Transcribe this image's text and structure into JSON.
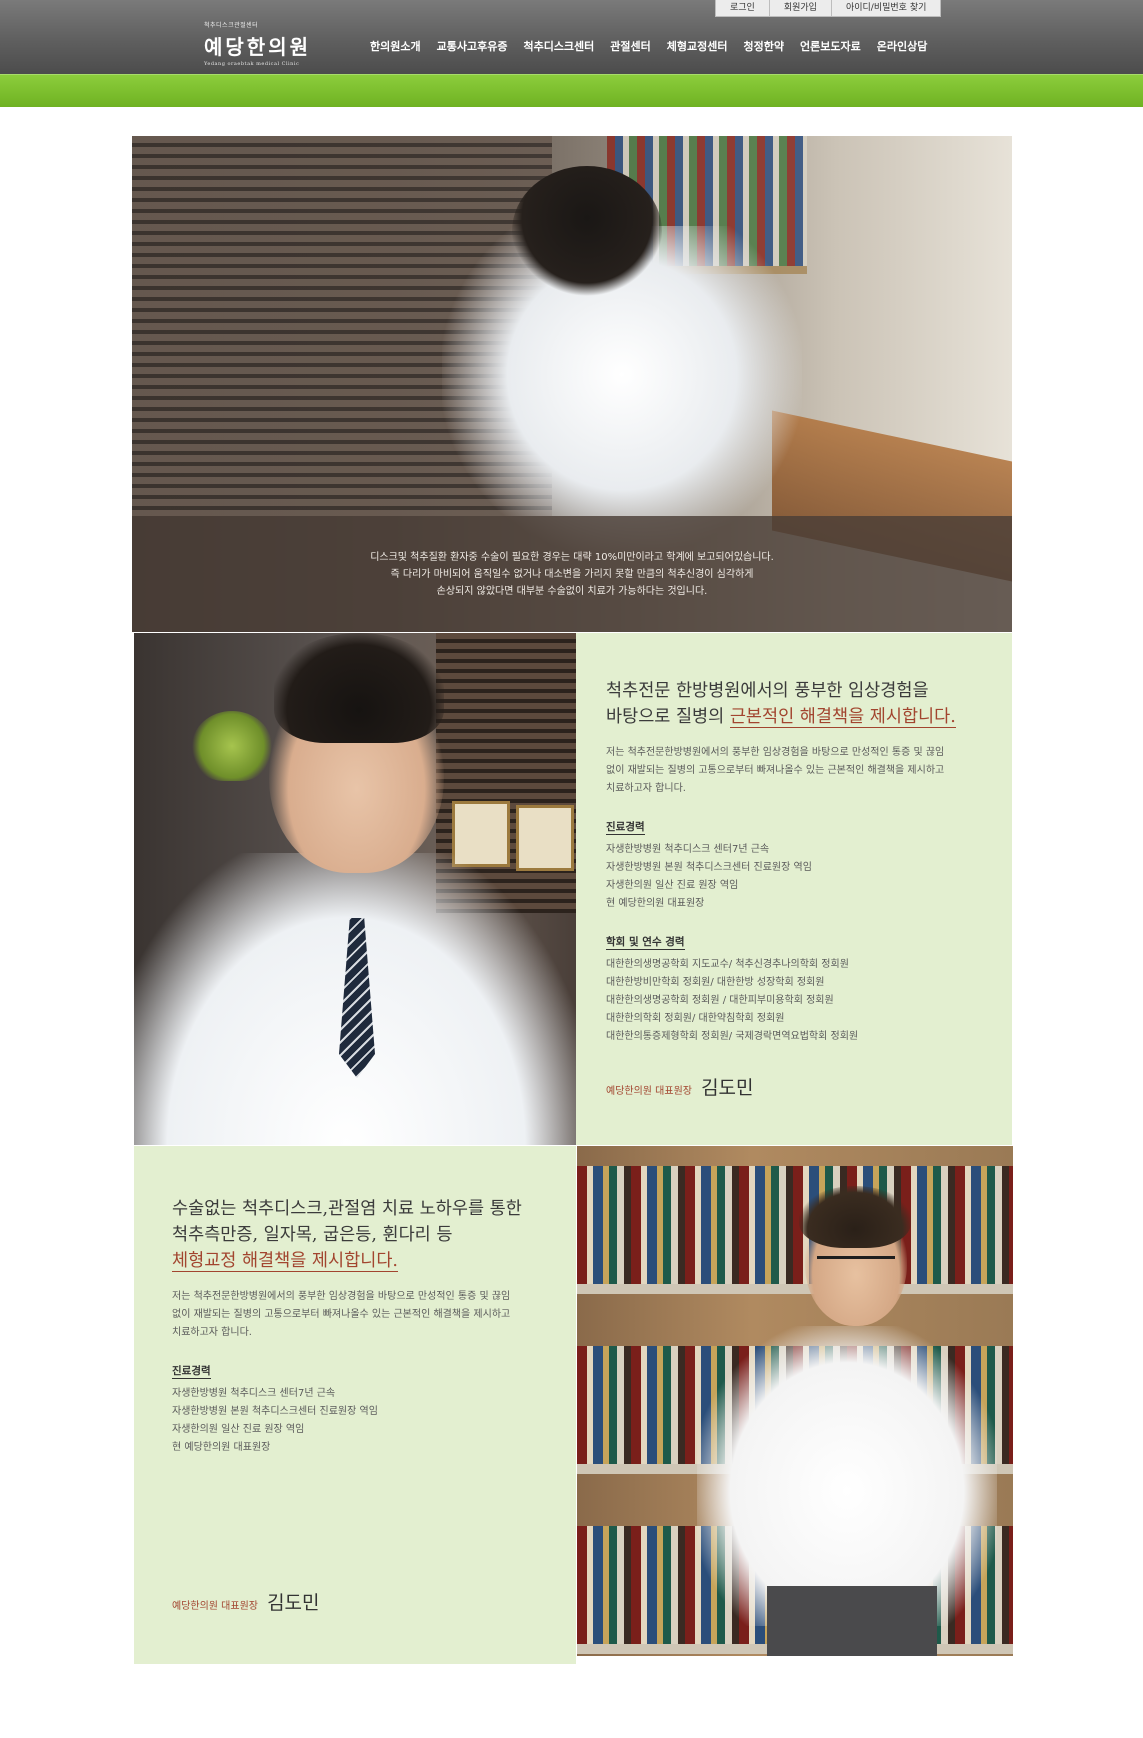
{
  "header": {
    "logo_small": "척추디스크관절센터",
    "logo_main": "예당한의원",
    "logo_en": "Yedang oraebtak medical Clinic",
    "util": [
      "로그인",
      "회원가입",
      "아이디/비밀번호 찾기"
    ],
    "nav": [
      "한의원소개",
      "교통사고후유증",
      "척추디스크센터",
      "관절센터",
      "체형교정센터",
      "청정한약",
      "언론보도자료",
      "온라인상담"
    ]
  },
  "hero": {
    "caption": [
      "디스크및 척추질환 환자중 수술이 필요한 경우는 대략 10%미만이라고 학계에 보고되어있습니다.",
      "즉 다리가 마비되어 움직일수 없거나 대소변을 가리지 못할 만큼의 척추신경이 심각하게",
      "손상되지 않았다면 대부분 수술없이 치료가 가능하다는 것입니다."
    ]
  },
  "doctor1": {
    "headline_line1": "척추전문 한방병원에서의 풍부한 임상경험을",
    "headline_line2_prefix": "바탕으로 질병의 ",
    "headline_line2_accent": "근본적인 해결책을 제시합니다.",
    "intro": [
      "저는 척추전문한방병원에서의 풍부한 임상경험을 바탕으로 만성적인 통증 및 끊임",
      "없이 재발되는 질병의 고통으로부터 빠져나올수 있는 근본적인 해결책을 제시하고",
      "치료하고자 합니다."
    ],
    "career_title": "진료경력",
    "career": [
      "자생한방병원 척추디스크 센터7년 근속",
      "자생한방병원 본원 척추디스크센터 진료원장 역임",
      "자생한의원 일산 진료 원장 역임",
      "현 예당한의원 대표원장"
    ],
    "academic_title": "학회 및 연수 경력",
    "academic": [
      "대한한의생명공학회 지도교수/ 척추신경추나의학회 정회원",
      "대한한방비만학회 정회원/ 대한한방 성장학회 정회원",
      "대한한의생명공학회 정회원 / 대한피부미용학회 정회원",
      "대한한의학회 정회원/ 대한약침학회 정회원",
      "대한한의통증제형학회 정회원/ 국제경락면역요법학회 정회원"
    ],
    "sig_title": "예당한의원 대표원장",
    "sig_name": "김도민"
  },
  "doctor2": {
    "headline_line1": "수술없는 척추디스크,관절염 치료 노하우를 통한",
    "headline_line2": "척추측만증, 일자목, 굽은등, 휜다리 등",
    "headline_line3_accent": "체형교정 해결책을 제시합니다.",
    "intro": [
      "저는 척추전문한방병원에서의 풍부한 임상경험을 바탕으로 만성적인 통증 및 끊임",
      "없이 재발되는 질병의 고통으로부터 빠져나올수 있는 근본적인 해결책을 제시하고",
      "치료하고자 합니다."
    ],
    "career_title": "진료경력",
    "career": [
      "자생한방병원 척추디스크 센터7년 근속",
      "자생한방병원 본원 척추디스크센터 진료원장 역임",
      "자생한의원 일산 진료 원장 역임",
      "현 예당한의원 대표원장"
    ],
    "sig_title": "예당한의원 대표원장",
    "sig_name": "김도민"
  },
  "colors": {
    "header": "#5f5f5f",
    "green_bar": "#7bbd2c",
    "panel_green": "#e3efd0",
    "accent": "#a2452f"
  }
}
